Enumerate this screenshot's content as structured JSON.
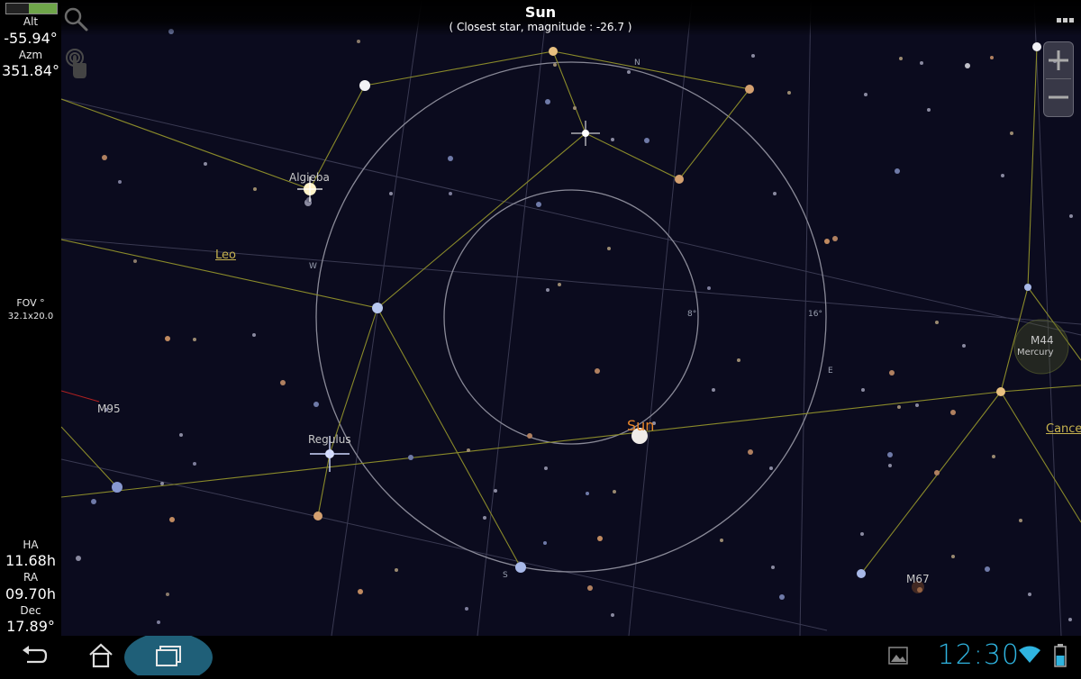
{
  "status": {
    "battery_level": 0.55,
    "battery_color": "#6fa54a"
  },
  "header": {
    "title": "Sun",
    "subtitle": "( Closest star, magnitude : -26.7 )"
  },
  "sidebar": {
    "alt_label": "Alt",
    "alt_value": "-55.94°",
    "azm_label": "Azm",
    "azm_value": "351.84°",
    "fov_label": "FOV °",
    "fov_value": "32.1x20.0",
    "ha_label": "HA",
    "ha_value": "11.68h",
    "ra_label": "RA",
    "ra_value": "09.70h",
    "dec_label": "Dec",
    "dec_value": "17.89°"
  },
  "sky": {
    "stars": [
      {
        "name": "Algieba"
      },
      {
        "name": "Regulus"
      },
      {
        "name": "Sun"
      }
    ],
    "objects": {
      "m95": "M95",
      "m44": "M44",
      "mercury": "Mercury",
      "m67": "M67"
    },
    "constellations": {
      "leo": "Leo",
      "cancer": "Cance"
    },
    "directions": {
      "n": "N",
      "w": "W",
      "e": "E",
      "s": "S"
    },
    "fov_rings": {
      "inner": "8°",
      "outer": "16°"
    },
    "colors": {
      "sky": "#0b0b1e",
      "constellation_line": "#8a8a2a",
      "grid_line": "#3a3a52",
      "ring": "#8a8a98",
      "sun_label": "#e8862a",
      "label": "#c7b34e"
    }
  },
  "navbar": {
    "clock": "12:30",
    "clock_color": "#2fb4e0",
    "icons": [
      "back-icon",
      "home-icon",
      "recent-apps-icon",
      "gallery-icon",
      "wifi-icon",
      "battery-icon"
    ]
  }
}
